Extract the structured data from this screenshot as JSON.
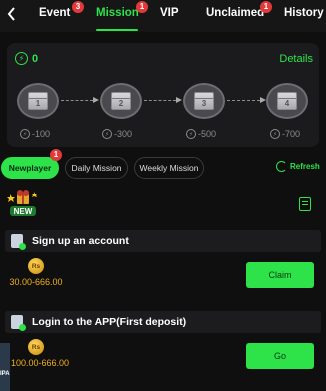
{
  "header": {
    "back_icon": "chevron-left-icon",
    "tabs": [
      {
        "label": "Event",
        "badge": "3",
        "active": false
      },
      {
        "label": "Mission",
        "badge": "1",
        "active": true
      },
      {
        "label": "VIP",
        "badge": "",
        "active": false
      },
      {
        "label": "Unclaimed",
        "badge": "1",
        "active": false
      },
      {
        "label": "History",
        "badge": "",
        "active": false
      }
    ]
  },
  "progress_card": {
    "count": "0",
    "details_label": "Details",
    "chests": [
      {
        "number": "1",
        "reward": "-100"
      },
      {
        "number": "2",
        "reward": "-300"
      },
      {
        "number": "3",
        "reward": "-500"
      },
      {
        "number": "4",
        "reward": "-700"
      }
    ]
  },
  "filters": {
    "pills": [
      {
        "label": "Newplayer",
        "badge": "1",
        "active": true
      },
      {
        "label": "Daily Mission",
        "badge": "",
        "active": false
      },
      {
        "label": "Weekly Mission",
        "badge": "",
        "active": false
      }
    ],
    "refresh_label": "Refresh"
  },
  "new_badge_label": "NEW",
  "tasks": [
    {
      "title": "Sign up an account",
      "coin_label": "Rs",
      "amount": "30.00-666.00",
      "button": "Claim"
    },
    {
      "title": "Login to the APP(First deposit)",
      "coin_label": "Rs",
      "amount": "100.00-666.00",
      "button": "Go"
    }
  ],
  "side_strip_label": "IPA",
  "colors": {
    "accent": "#2ee24a",
    "badge": "#e23a3a",
    "amount": "#f0b020"
  }
}
